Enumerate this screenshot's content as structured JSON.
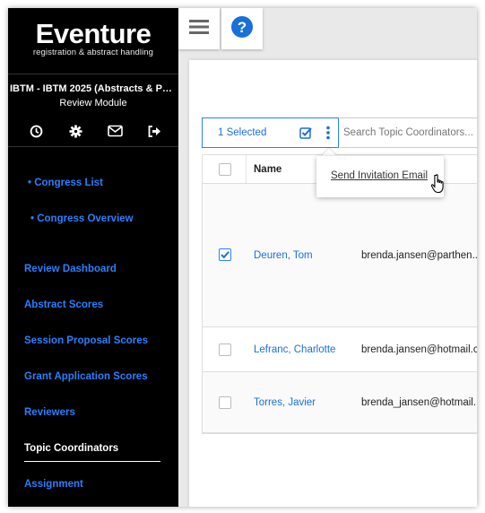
{
  "colors": {
    "accent": "#2a7fff",
    "link": "#1a6fd8",
    "sidebar_bg": "#000000"
  },
  "sidebar": {
    "logo_title": "Eventure",
    "logo_subtitle": "registration & abstract handling",
    "congress_name": "IBTM - IBTM 2025 (Abstracts & Par...",
    "module_name": "Review Module",
    "icons": [
      "clock-icon",
      "gear-icon",
      "envelope-icon",
      "sign-out-icon"
    ],
    "sub_items": [
      "• Congress List",
      "• Congress Overview"
    ],
    "items": [
      {
        "label": "Review Dashboard",
        "active": false
      },
      {
        "label": "Abstract Scores",
        "active": false
      },
      {
        "label": "Session Proposal Scores",
        "active": false
      },
      {
        "label": "Grant Application Scores",
        "active": false
      },
      {
        "label": "Reviewers",
        "active": false
      },
      {
        "label": "Topic Coordinators",
        "active": true
      },
      {
        "label": "Assignment",
        "active": false
      }
    ]
  },
  "header": {
    "menu_icon": "hamburger-icon",
    "help_icon": "help-icon"
  },
  "toolbar": {
    "selected_label": "1 Selected",
    "search_placeholder": "Search Topic Coordinators..."
  },
  "dropdown": {
    "item": "Send Invitation Email"
  },
  "table": {
    "headers": {
      "name": "Name"
    },
    "rows": [
      {
        "checked": true,
        "name": "Deuren, Tom",
        "email": "brenda.jansen@parthen..."
      },
      {
        "checked": false,
        "name": "Lefranc, Charlotte",
        "email": "brenda.jansen@hotmail.c"
      },
      {
        "checked": false,
        "name": "Torres, Javier",
        "email": "brenda_jansen@hotmail."
      }
    ]
  }
}
